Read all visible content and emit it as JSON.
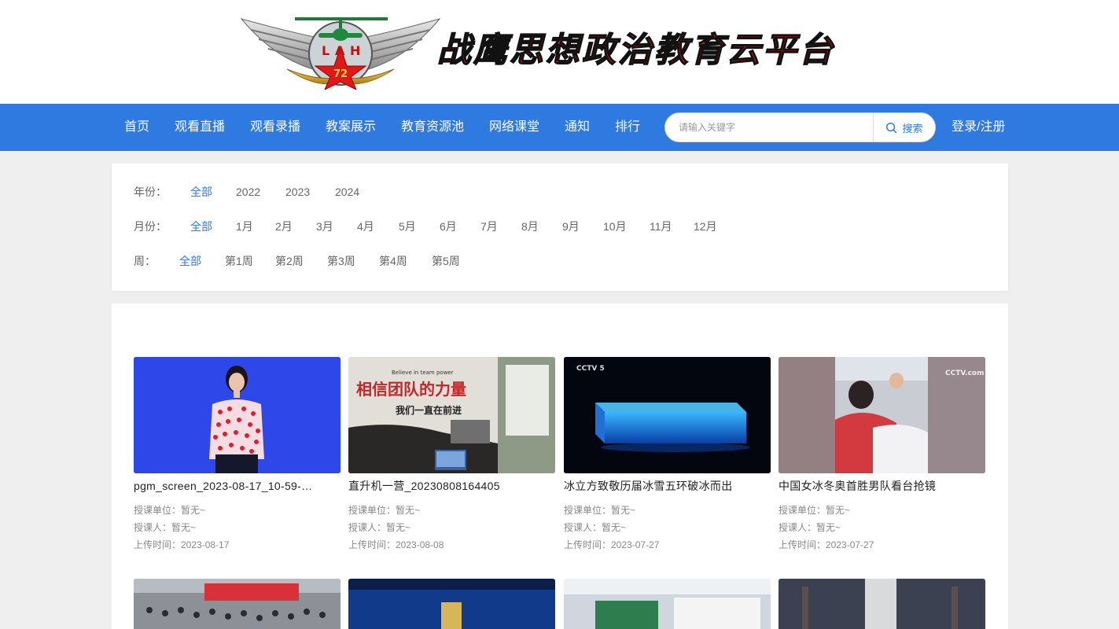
{
  "header": {
    "site_title": "战鹰思想政治教育云平台",
    "logo_letters": "LAH",
    "logo_number": "72"
  },
  "nav": {
    "items": [
      {
        "label": "首页"
      },
      {
        "label": "观看直播"
      },
      {
        "label": "观看录播"
      },
      {
        "label": "教案展示"
      },
      {
        "label": "教育资源池"
      },
      {
        "label": "网络课堂"
      },
      {
        "label": "通知"
      },
      {
        "label": "排行"
      }
    ],
    "search_placeholder": "请输入关键字",
    "search_button": "搜索",
    "search_icon": "search-icon",
    "login": "登录/注册",
    "bg_color": "#2f7ae0"
  },
  "filters": {
    "year": {
      "label": "年份：",
      "options": [
        "全部",
        "2022",
        "2023",
        "2024"
      ],
      "selected": "全部"
    },
    "month": {
      "label": "月份：",
      "options": [
        "全部",
        "1月",
        "2月",
        "3月",
        "4月",
        "5月",
        "6月",
        "7月",
        "8月",
        "9月",
        "10月",
        "11月",
        "12月"
      ],
      "selected": "全部"
    },
    "week": {
      "label": "周：",
      "options": [
        "全部",
        "第1周",
        "第2周",
        "第3周",
        "第4周",
        "第5周"
      ],
      "selected": "全部"
    },
    "active_color": "#2f7ae0"
  },
  "videos": [
    {
      "title": "pgm_screen_2023-08-17_10-59-…",
      "unit": "授课单位：暂无~",
      "teacher": "授课人：暂无~",
      "upload": "上传时间：2023-08-17"
    },
    {
      "title": "直升机一营_20230808164405",
      "unit": "授课单位：暂无~",
      "teacher": "授课人：暂无~",
      "upload": "上传时间：2023-08-08",
      "poster_text": "相信团队的力量",
      "poster_text2": "我们一直在前进",
      "poster_small": "Believe in team power"
    },
    {
      "title": "冰立方致敬历届冰雪五环破冰而出",
      "unit": "授课单位：暂无~",
      "teacher": "授课人：暂无~",
      "upload": "上传时间：2023-07-27",
      "channel": "CCTV 5"
    },
    {
      "title": "中国女冰冬奥首胜男队看台抢镜",
      "unit": "授课单位：暂无~",
      "teacher": "授课人：暂无~",
      "upload": "上传时间：2023-07-27",
      "channel": "CCTV.com"
    }
  ]
}
